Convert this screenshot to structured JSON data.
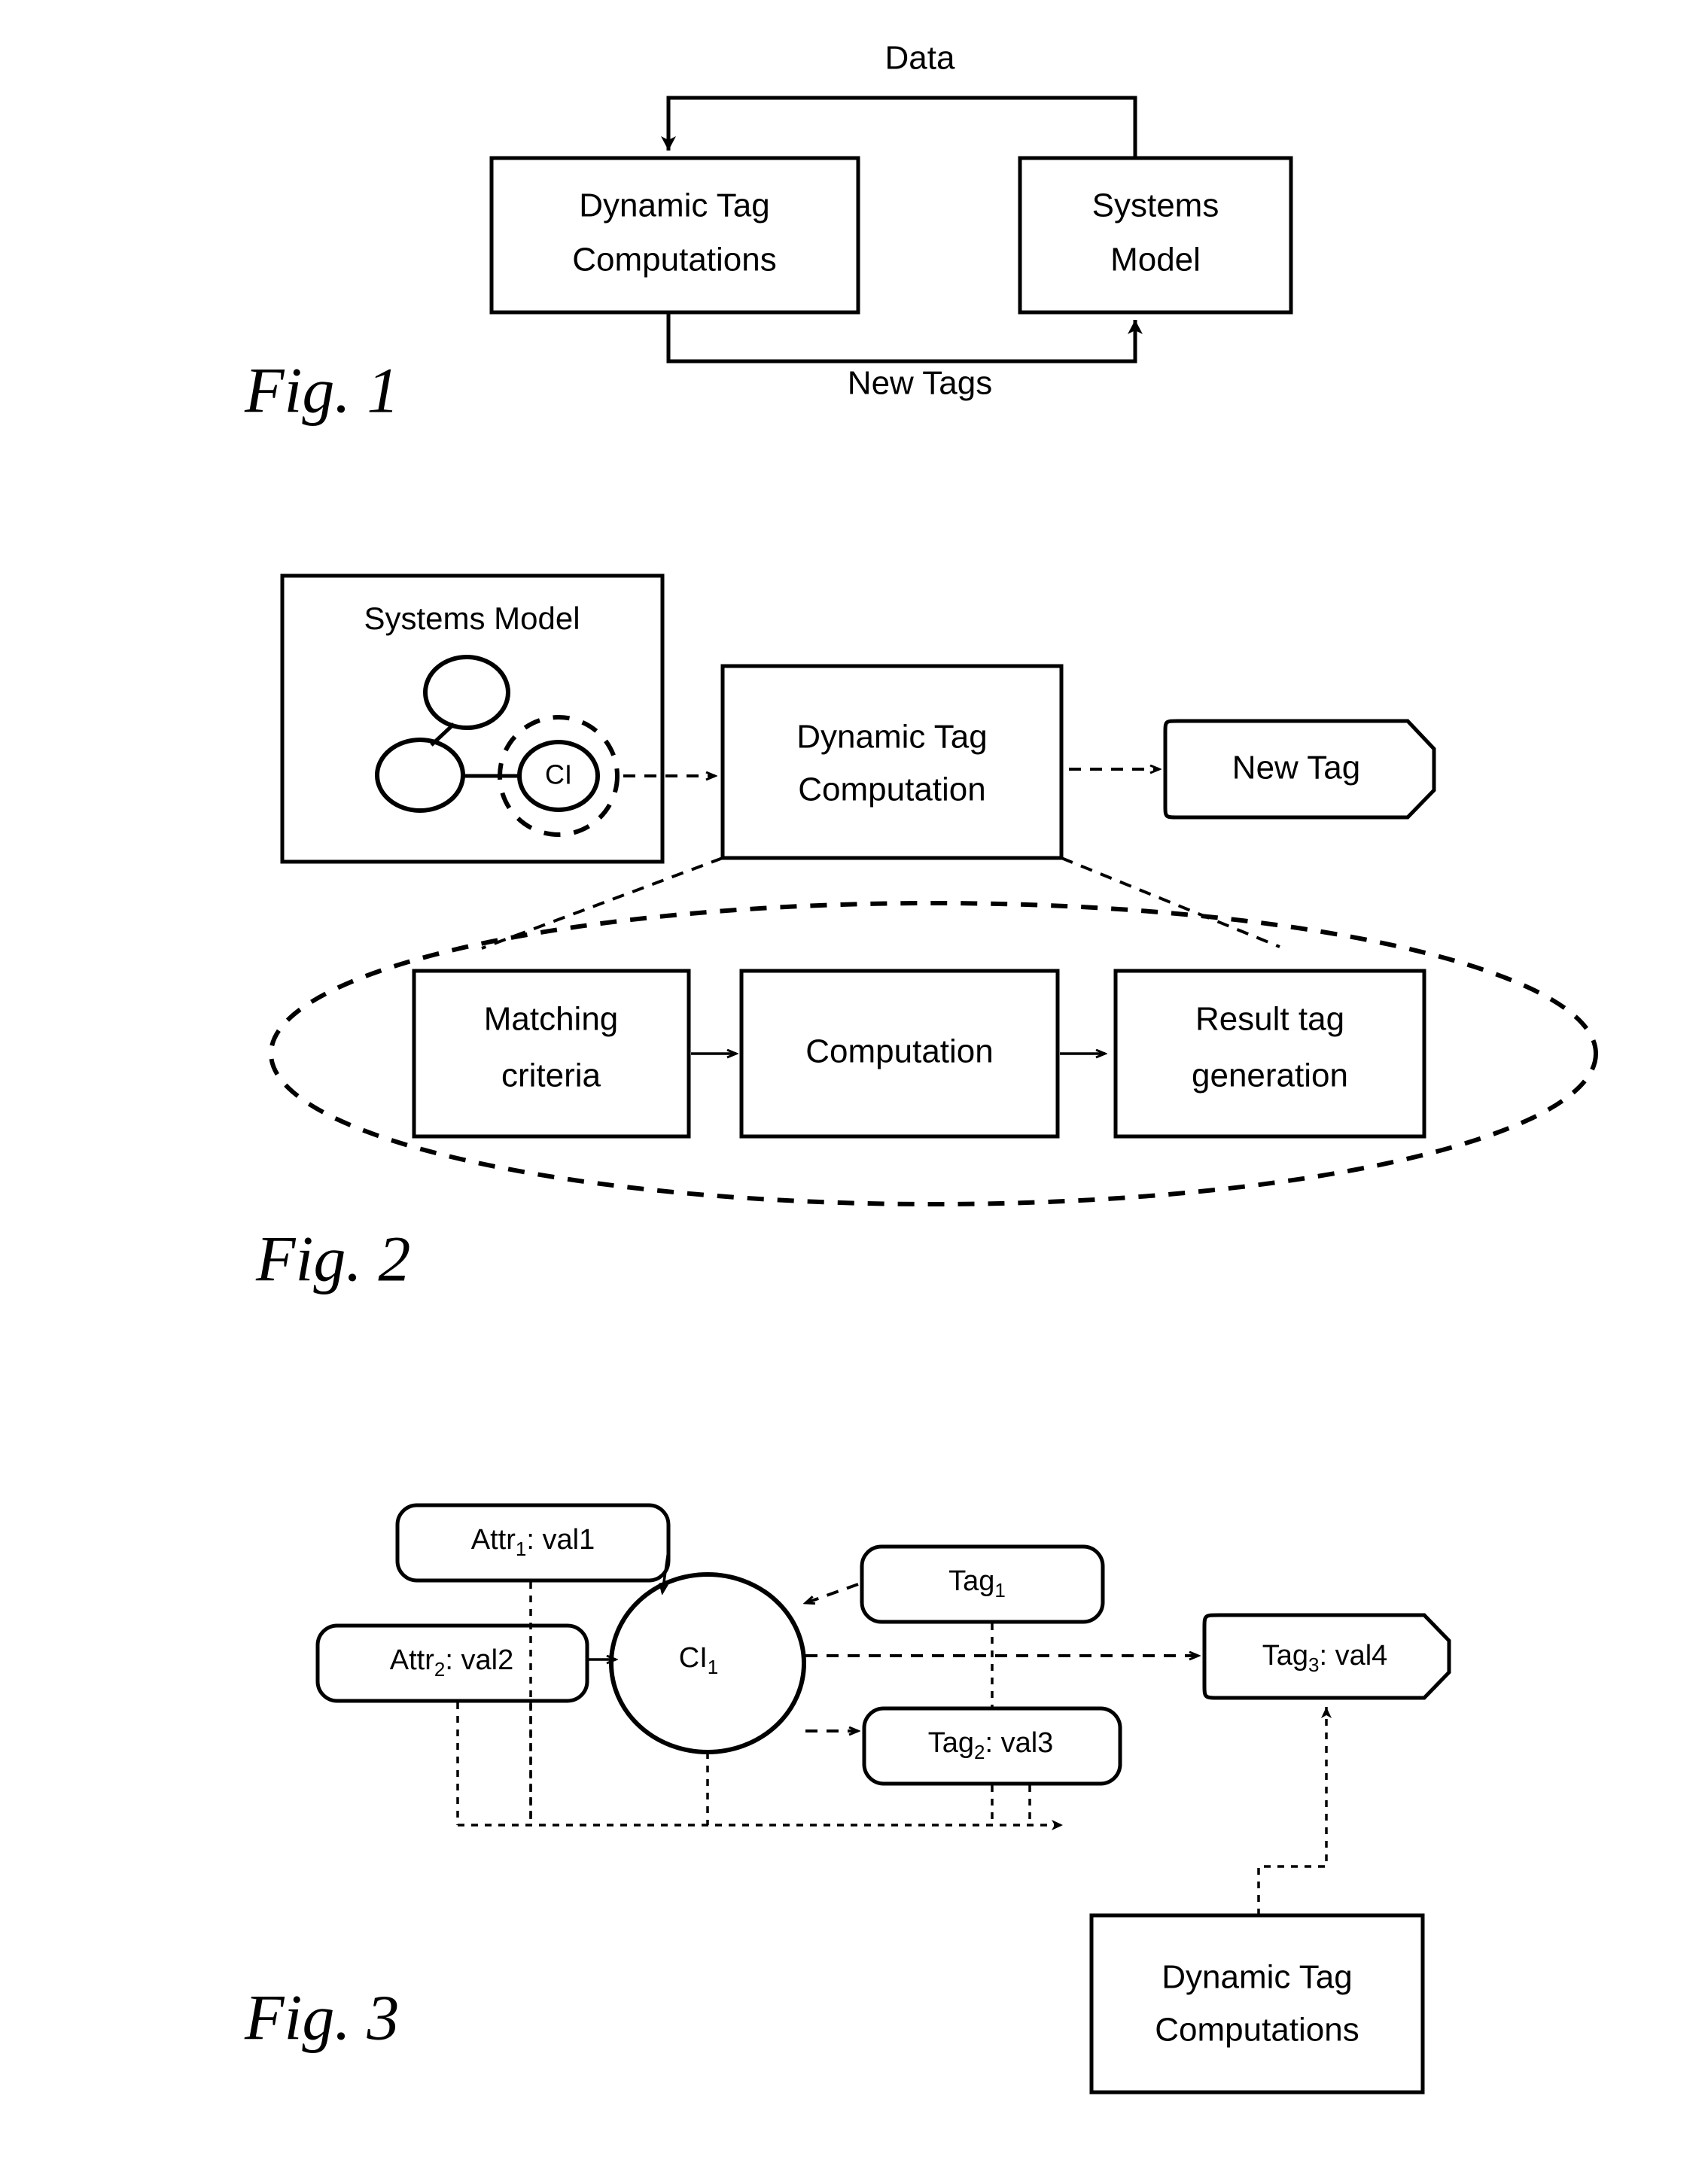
{
  "figures": [
    {
      "caption": "Fig. 1",
      "flows": {
        "top_label": "Data",
        "bottom_label": "New Tags"
      },
      "boxes": [
        {
          "id": "dtc",
          "line1": "Dynamic Tag",
          "line2": "Computations"
        },
        {
          "id": "sm",
          "line1": "Systems",
          "line2": "Model"
        }
      ]
    },
    {
      "caption": "Fig. 2",
      "boxes": [
        {
          "id": "systems-model",
          "title": "Systems Model"
        },
        {
          "id": "dynamic-tag-computation",
          "line1": "Dynamic Tag",
          "line2": "Computation"
        },
        {
          "id": "new-tag",
          "label": "New Tag"
        }
      ],
      "graph": {
        "ci_label": "CI"
      },
      "expansion": [
        {
          "id": "matching-criteria",
          "line1": "Matching",
          "line2": "criteria"
        },
        {
          "id": "computation",
          "line1": "Computation",
          "line2": ""
        },
        {
          "id": "result-tag-generation",
          "line1": "Result tag",
          "line2": "generation"
        }
      ]
    },
    {
      "caption": "Fig. 3",
      "nodes": [
        {
          "id": "attr1",
          "base": "Attr",
          "sub": "1",
          "value": ": val1"
        },
        {
          "id": "attr2",
          "base": "Attr",
          "sub": "2",
          "value": ": val2"
        },
        {
          "id": "tag1",
          "base": "Tag",
          "sub": "1",
          "value": ""
        },
        {
          "id": "tag2",
          "base": "Tag",
          "sub": "2",
          "value": ": val3"
        },
        {
          "id": "tag3",
          "base": "Tag",
          "sub": "3",
          "value": ": val4"
        }
      ],
      "ci": {
        "base": "CI",
        "sub": "1"
      },
      "dtc_box": {
        "line1": "Dynamic Tag",
        "line2": "Computations"
      }
    }
  ],
  "colors": {
    "ink": "#000000",
    "paper": "#ffffff"
  }
}
